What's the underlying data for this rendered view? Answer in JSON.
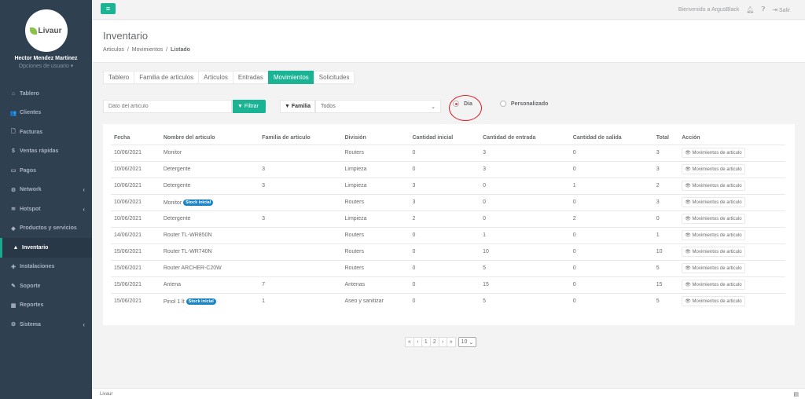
{
  "brand": {
    "logo_text": "Livaur",
    "accent": "#1ab394",
    "sidebar_bg": "#2f4050"
  },
  "user": {
    "name": "Hector Mendez Martinez",
    "options": "Opciones de usuario ▾"
  },
  "sidebar": {
    "items": [
      {
        "label": "Tablero",
        "icon": "dashboard-icon",
        "glyph": "⌂",
        "arrow": ""
      },
      {
        "label": "Clientes",
        "icon": "users-icon",
        "glyph": "👥",
        "arrow": ""
      },
      {
        "label": "Facturas",
        "icon": "file-icon",
        "glyph": "🗋",
        "arrow": ""
      },
      {
        "label": "Ventas rápidas",
        "icon": "dollar-icon",
        "glyph": "$",
        "arrow": ""
      },
      {
        "label": "Pagos",
        "icon": "money-icon",
        "glyph": "▭",
        "arrow": ""
      },
      {
        "label": "Network",
        "icon": "network-icon",
        "glyph": "⚙",
        "arrow": "‹"
      },
      {
        "label": "Hotspot",
        "icon": "wifi-icon",
        "glyph": "≋",
        "arrow": "‹"
      },
      {
        "label": "Productos y servicios",
        "icon": "tag-icon",
        "glyph": "◆",
        "arrow": ""
      },
      {
        "label": "Inventario",
        "icon": "cubes-icon",
        "glyph": "▲",
        "arrow": "",
        "active": true
      },
      {
        "label": "Instalaciones",
        "icon": "wrench-icon",
        "glyph": "✚",
        "arrow": ""
      },
      {
        "label": "Soporte",
        "icon": "support-icon",
        "glyph": "✎",
        "arrow": ""
      },
      {
        "label": "Reportes",
        "icon": "chart-icon",
        "glyph": "▦",
        "arrow": ""
      },
      {
        "label": "Sistema",
        "icon": "cogs-icon",
        "glyph": "⚙",
        "arrow": "‹"
      }
    ]
  },
  "topbar": {
    "welcome": "Bienvenido a ArgusBlack",
    "logout": "Salir"
  },
  "header": {
    "title": "Inventario",
    "crumb1": "Articulos",
    "crumb2": "Movimientos",
    "crumb3": "Listado",
    "sep": "/"
  },
  "tabs": [
    "Tablero",
    "Familia de articulos",
    "Articulos",
    "Entradas",
    "Movimientos",
    "Solicitudes"
  ],
  "filters": {
    "search_placeholder": "Dato del articulo",
    "filter_button": "Filtrar",
    "family_label": "Familia",
    "family_value": "Todos",
    "radio_day": "Dia",
    "radio_custom": "Personalizado"
  },
  "table": {
    "headers": [
      "Fecha",
      "Nombre del articulo",
      "Familia de articulo",
      "División",
      "Cantidad inicial",
      "Cantidad de entrada",
      "Cantidad de salida",
      "Total",
      "Acción"
    ],
    "action_label": "Movimientos de articulo",
    "rows": [
      {
        "fecha": "10/06/2021",
        "nombre": "Monitor",
        "badge": "",
        "familia": "",
        "division": "Routers",
        "inicial": "0",
        "entrada": "3",
        "salida": "0",
        "total": "3"
      },
      {
        "fecha": "10/06/2021",
        "nombre": "Detergente",
        "badge": "",
        "familia": "3",
        "division": "Limpieza",
        "inicial": "0",
        "entrada": "3",
        "salida": "0",
        "total": "3"
      },
      {
        "fecha": "10/06/2021",
        "nombre": "Detergente",
        "badge": "",
        "familia": "3",
        "division": "Limpieza",
        "inicial": "3",
        "entrada": "0",
        "salida": "1",
        "total": "2"
      },
      {
        "fecha": "10/06/2021",
        "nombre": "Monitor",
        "badge": "Stock inicial",
        "familia": "",
        "division": "Routers",
        "inicial": "3",
        "entrada": "0",
        "salida": "0",
        "total": "3"
      },
      {
        "fecha": "10/06/2021",
        "nombre": "Detergente",
        "badge": "",
        "familia": "3",
        "division": "Limpieza",
        "inicial": "2",
        "entrada": "0",
        "salida": "2",
        "total": "0"
      },
      {
        "fecha": "14/06/2021",
        "nombre": "Router TL-WR850N",
        "badge": "",
        "familia": "",
        "division": "Routers",
        "inicial": "0",
        "entrada": "1",
        "salida": "0",
        "total": "1"
      },
      {
        "fecha": "15/06/2021",
        "nombre": "Router TL-WR740N",
        "badge": "",
        "familia": "",
        "division": "Routers",
        "inicial": "0",
        "entrada": "10",
        "salida": "0",
        "total": "10"
      },
      {
        "fecha": "15/06/2021",
        "nombre": "Router ARCHER-C20W",
        "badge": "",
        "familia": "",
        "division": "Routers",
        "inicial": "0",
        "entrada": "5",
        "salida": "0",
        "total": "5"
      },
      {
        "fecha": "15/06/2021",
        "nombre": "Antena",
        "badge": "",
        "familia": "7",
        "division": "Antenas",
        "inicial": "0",
        "entrada": "15",
        "salida": "0",
        "total": "15"
      },
      {
        "fecha": "15/06/2021",
        "nombre": "Pinol 1 lt",
        "badge": "Stock inicial",
        "familia": "1",
        "division": "Aseo y sanitizar",
        "inicial": "0",
        "entrada": "5",
        "salida": "0",
        "total": "5"
      }
    ]
  },
  "pagination": {
    "first": "«",
    "prev": "‹",
    "pages": [
      "1",
      "2"
    ],
    "next": "›",
    "last": "»",
    "per_page": "10"
  },
  "footer": {
    "text": "Livaur"
  }
}
